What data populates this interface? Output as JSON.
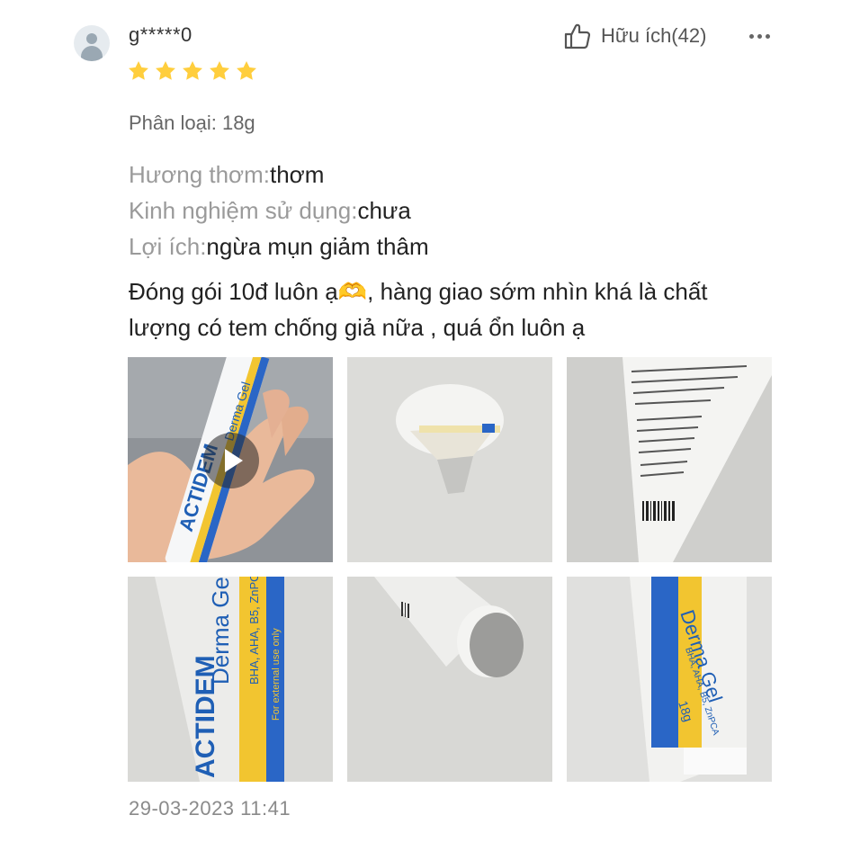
{
  "review": {
    "username": "g*****0",
    "rating": 5,
    "helpful_label": "Hữu ích(42)",
    "variant": "Phân loại: 18g",
    "attributes": [
      {
        "key": "Hương thơm:",
        "value": "thơm"
      },
      {
        "key": "Kinh nghiệm sử dụng:",
        "value": "chưa"
      },
      {
        "key": "Lợi ích:",
        "value": "ngừa mụn giảm thâm"
      }
    ],
    "content_line1": "Đóng gói 10đ luôn ạ🫶, hàng giao sớm nhìn khá là chất",
    "content_line2": "lượng có tem chống giả nữa , quá ổn luôn ạ",
    "timestamp": "29-03-2023 11:41",
    "photo_text": {
      "brand": "ACTIDEM",
      "product": "Derma Gel",
      "tagline": "BHA, AHA, B5, ZnPCA",
      "volume": "18g",
      "external_use": "For external use only"
    }
  },
  "colors": {
    "star": "#ffce3d",
    "brand_blue": "#1f5fb5",
    "label_yellow": "#f2c530"
  }
}
